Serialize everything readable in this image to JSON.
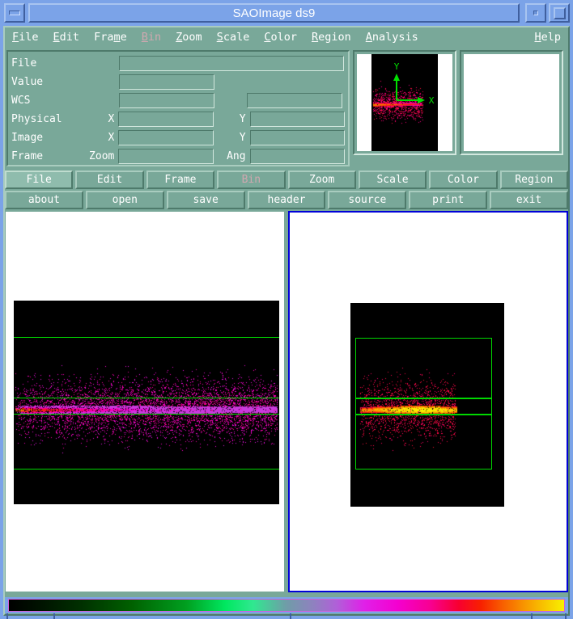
{
  "window": {
    "title": "SAOImage ds9",
    "minimize_icon": "minimize-icon",
    "restore_icon": "restore-icon",
    "maximize_icon": "maximize-icon"
  },
  "menubar": {
    "items": [
      {
        "label": "File",
        "mnemonic": "F",
        "enabled": true
      },
      {
        "label": "Edit",
        "mnemonic": "E",
        "enabled": true
      },
      {
        "label": "Frame",
        "mnemonic": "m",
        "enabled": true
      },
      {
        "label": "Bin",
        "mnemonic": "B",
        "enabled": false
      },
      {
        "label": "Zoom",
        "mnemonic": "Z",
        "enabled": true
      },
      {
        "label": "Scale",
        "mnemonic": "S",
        "enabled": true
      },
      {
        "label": "Color",
        "mnemonic": "C",
        "enabled": true
      },
      {
        "label": "Region",
        "mnemonic": "R",
        "enabled": true
      },
      {
        "label": "Analysis",
        "mnemonic": "A",
        "enabled": true
      }
    ],
    "help": {
      "label": "Help",
      "mnemonic": "H",
      "enabled": true
    }
  },
  "info_panel": {
    "rows": [
      {
        "label": "File",
        "sub": "",
        "value": "",
        "value2": "",
        "sub2": ""
      },
      {
        "label": "Value",
        "sub": "",
        "value": "",
        "value2": "",
        "sub2": ""
      },
      {
        "label": "WCS",
        "sub": "",
        "value": "",
        "value2": "",
        "sub2": ""
      },
      {
        "label": "Physical",
        "sub": "X",
        "value": "",
        "value2": "",
        "sub2": "Y"
      },
      {
        "label": "Image",
        "sub": "X",
        "value": "",
        "value2": "",
        "sub2": "Y"
      },
      {
        "label": "Frame",
        "sub": "Zoom",
        "value": "",
        "value2": "",
        "sub2": "Ang"
      }
    ]
  },
  "panner": {
    "name": "panner",
    "compass_x_label": "X",
    "compass_y_label": "Y",
    "compass_color": "#00e000"
  },
  "magnifier": {
    "name": "magnifier",
    "content": ""
  },
  "button_bar": {
    "row1": [
      {
        "label": "File",
        "active": true,
        "enabled": true
      },
      {
        "label": "Edit",
        "active": false,
        "enabled": true
      },
      {
        "label": "Frame",
        "active": false,
        "enabled": true
      },
      {
        "label": "Bin",
        "active": false,
        "enabled": false
      },
      {
        "label": "Zoom",
        "active": false,
        "enabled": true
      },
      {
        "label": "Scale",
        "active": false,
        "enabled": true
      },
      {
        "label": "Color",
        "active": false,
        "enabled": true
      },
      {
        "label": "Region",
        "active": false,
        "enabled": true
      }
    ],
    "row2": [
      {
        "label": "about",
        "active": false,
        "enabled": true
      },
      {
        "label": "open",
        "active": false,
        "enabled": true
      },
      {
        "label": "save",
        "active": false,
        "enabled": true
      },
      {
        "label": "header",
        "active": false,
        "enabled": true
      },
      {
        "label": "source",
        "active": false,
        "enabled": true
      },
      {
        "label": "print",
        "active": false,
        "enabled": true
      },
      {
        "label": "exit",
        "active": false,
        "enabled": true
      }
    ]
  },
  "frames": [
    {
      "name": "frame-1",
      "active": false,
      "region_color": "#00d800",
      "background": "#ffffff",
      "image_background": "#000000"
    },
    {
      "name": "frame-2",
      "active": true,
      "region_color": "#00d800",
      "background": "#ffffff",
      "image_background": "#000000"
    }
  ],
  "colorbar": {
    "name": "colorbar",
    "colormap": "cool/rainbow",
    "stops": [
      "#000000",
      "#003000",
      "#006000",
      "#00a020",
      "#00e860",
      "#709ca8",
      "#9080c0",
      "#e020e8",
      "#f400d0",
      "#f80030",
      "#f82000",
      "#f86000",
      "#f89800",
      "#f8f000"
    ]
  },
  "colors": {
    "titlebar": "#7ba3e8",
    "panel": "#79a899",
    "panel_light": "#a9ccbf",
    "panel_dark": "#4e7a6b",
    "text": "#ffffff",
    "disabled_text": "#cfa8b0",
    "active_frame_border": "#0000d8",
    "region_green": "#00d800"
  }
}
